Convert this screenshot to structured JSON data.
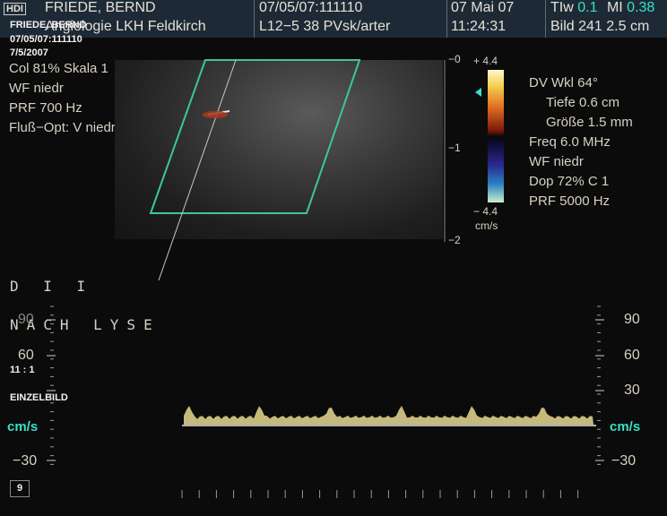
{
  "header": {
    "logo": "HDI",
    "patient_name": "FRIEDE, BERND",
    "institution": "Angiologie LKH Feldkirch",
    "study_id": "07/05/07:111110",
    "probe": "L12−5 38 PVsk/arter",
    "date": "07 Mai 07",
    "time": "11:24:31",
    "tis_label": "TIw",
    "tis_value": "0.1",
    "mi_label": "MI",
    "mi_value": "0.38",
    "image_label": "Bild 241 2.5 cm"
  },
  "overlay_small": {
    "name": "FRIEDE, BERND",
    "id": "07/05/07:111110",
    "date": "7/5/2007",
    "ratio": "11 : 1",
    "mode": "EINZELBILD"
  },
  "color_params": {
    "col": "Col 81%  Skala 1",
    "wf": "WF niedr",
    "prf": "PRF 700    Hz",
    "flow_opt": "Fluß−Opt: V niedr"
  },
  "depth_scale": [
    "0",
    "1",
    "2"
  ],
  "color_scale": {
    "top": "+ 4.4",
    "bottom": "− 4.4",
    "unit": "cm/s",
    "colors": [
      "#fff8c8",
      "#f5d050",
      "#e07020",
      "#7a1808",
      "#0a0a0a",
      "#2a2a90",
      "#2a80c0",
      "#c8f0d0"
    ]
  },
  "doppler_params": {
    "angle": "DV Wkl 64°",
    "depth": "Tiefe 0.6  cm",
    "size": "Größe 1.5  mm",
    "freq": "Freq 6.0  MHz",
    "wf": "WF niedr",
    "dop": "Dop 72%  C 1",
    "prf": "PRF 5000  Hz"
  },
  "annotations": {
    "line1": "D  I I",
    "line2": "NACH  LYSE"
  },
  "velocity_scale": {
    "labels": [
      "90",
      "60",
      "30",
      "cm/s",
      "−30"
    ],
    "unit": "cm/s"
  },
  "frame_badge": "9",
  "colors": {
    "header_bg": "#1d2a36",
    "accent_cyan": "#38e0c8",
    "roi_green": "#3cc890",
    "waveform": "#e8d890"
  }
}
